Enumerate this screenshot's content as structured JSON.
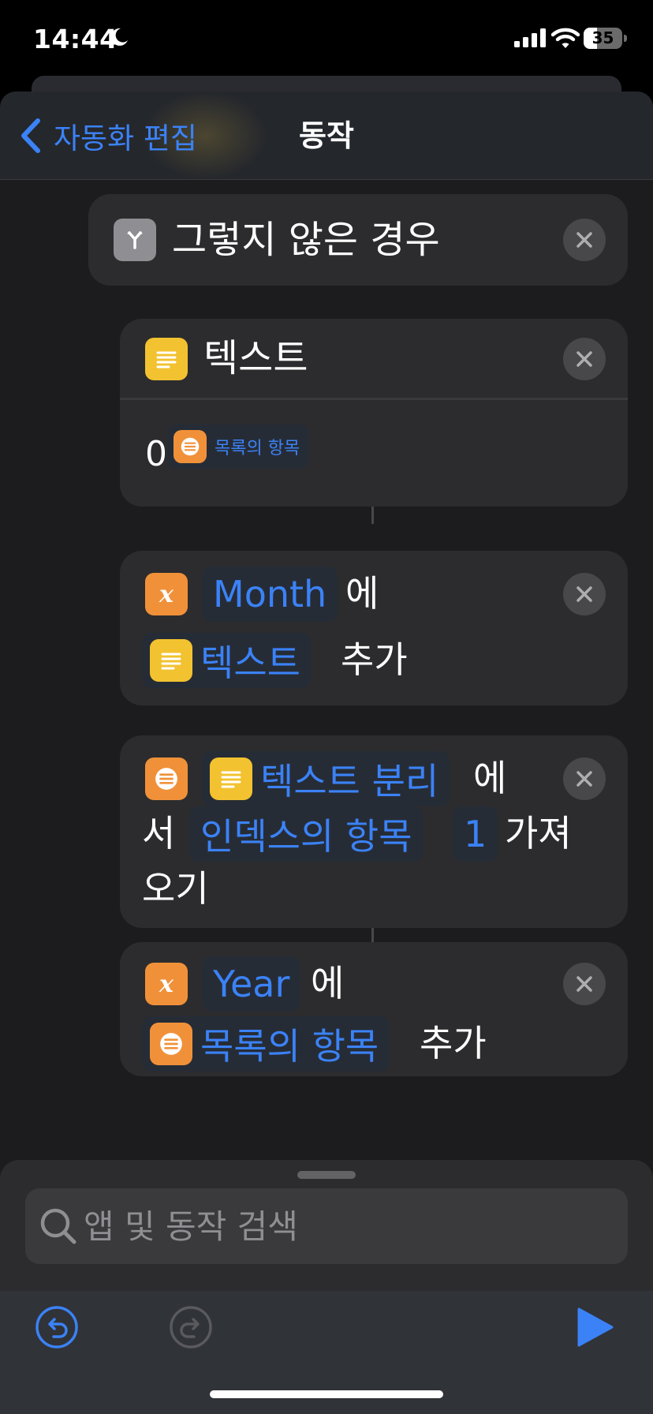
{
  "status_bar": {
    "time": "14:44",
    "battery_level": "35",
    "battery_fraction": 0.35
  },
  "nav": {
    "back_label": "자동화 편집",
    "title": "동작"
  },
  "otherwise_block": {
    "label": "그렇지 않은 경우",
    "icon": "branch-icon"
  },
  "text_action": {
    "title": "텍스트",
    "icon": "text-lines-icon",
    "content_prefix": "0",
    "content_variable": "목록의 항목"
  },
  "add_month_action": {
    "icon": "variable-x-icon",
    "variable": "Month",
    "word_to": "에",
    "value_chip": "텍스트",
    "word_add": "추가"
  },
  "get_item_action": {
    "icon": "list-icon",
    "source_chip": "텍스트 분리",
    "word_from_a": "에",
    "word_from_b": "서",
    "mode_chip": "인덱스의 항목",
    "index_chip": "1",
    "word_get_a": "가져",
    "word_get_b": "오기"
  },
  "add_year_action": {
    "icon": "variable-x-icon",
    "variable": "Year",
    "word_to": "에",
    "value_chip": "목록의 항목",
    "word_add": "추가"
  },
  "search": {
    "placeholder": "앱 및 동작 검색"
  },
  "colors": {
    "accent": "#3b82f6",
    "yellow": "#f2c230",
    "orange": "#f0913a",
    "background": "#1c1c1e",
    "card": "#2c2c2e"
  }
}
